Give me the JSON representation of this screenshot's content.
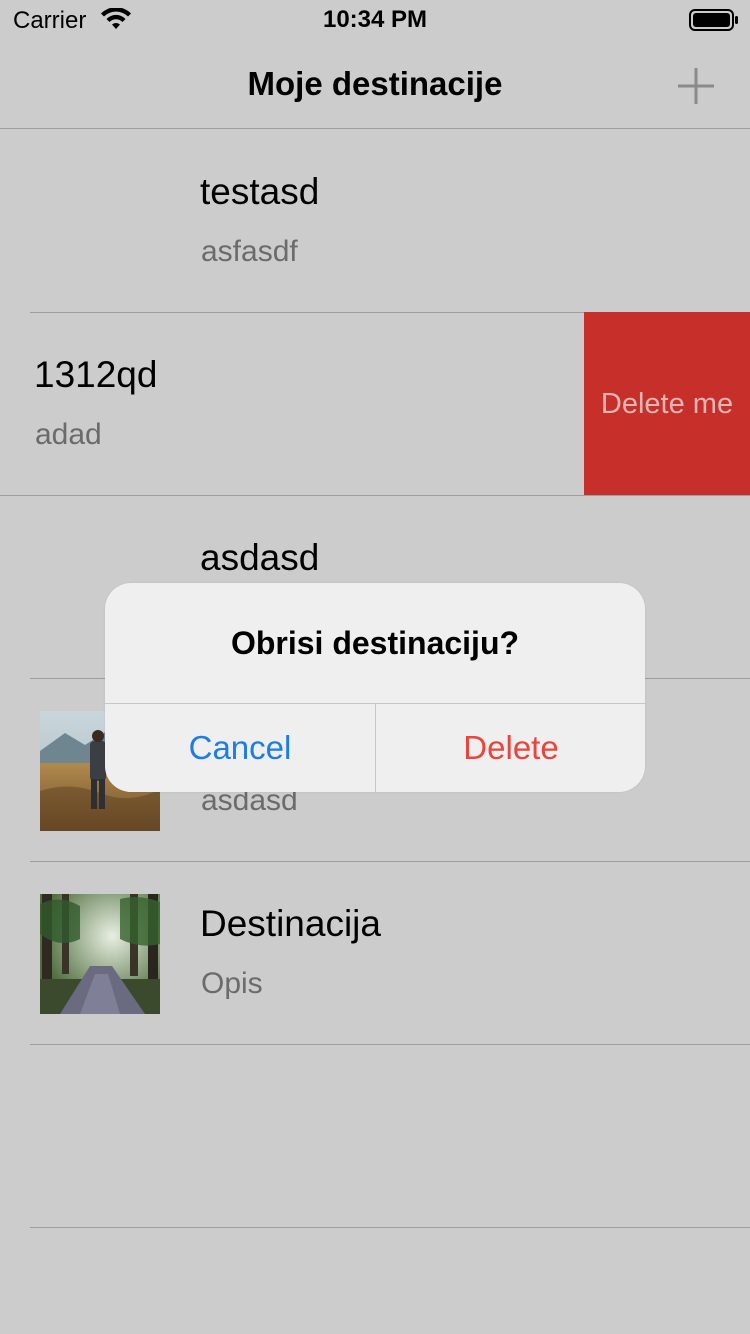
{
  "status_bar": {
    "carrier": "Carrier",
    "time": "10:34 PM"
  },
  "nav": {
    "title": "Moje destinacije",
    "add_icon": "plus-icon"
  },
  "rows": [
    {
      "title": "testasd",
      "subtitle": "asfasdf",
      "has_image": false
    },
    {
      "title": "1312qd",
      "subtitle": "adad",
      "has_image": false,
      "swiped": true,
      "action_label": "Delete me"
    },
    {
      "title": "asdasd",
      "subtitle": "",
      "has_image": false
    },
    {
      "title": "",
      "subtitle": "asdasd",
      "has_image": true,
      "image": "person-in-field"
    },
    {
      "title": "Destinacija",
      "subtitle": "Opis",
      "has_image": true,
      "image": "forest-road"
    }
  ],
  "alert": {
    "title": "Obrisi destinaciju?",
    "cancel_label": "Cancel",
    "delete_label": "Delete"
  },
  "colors": {
    "background": "#cccccc",
    "delete_action": "#c7302a",
    "cancel_blue": "#1a7ee6",
    "delete_red": "#e8453c"
  }
}
